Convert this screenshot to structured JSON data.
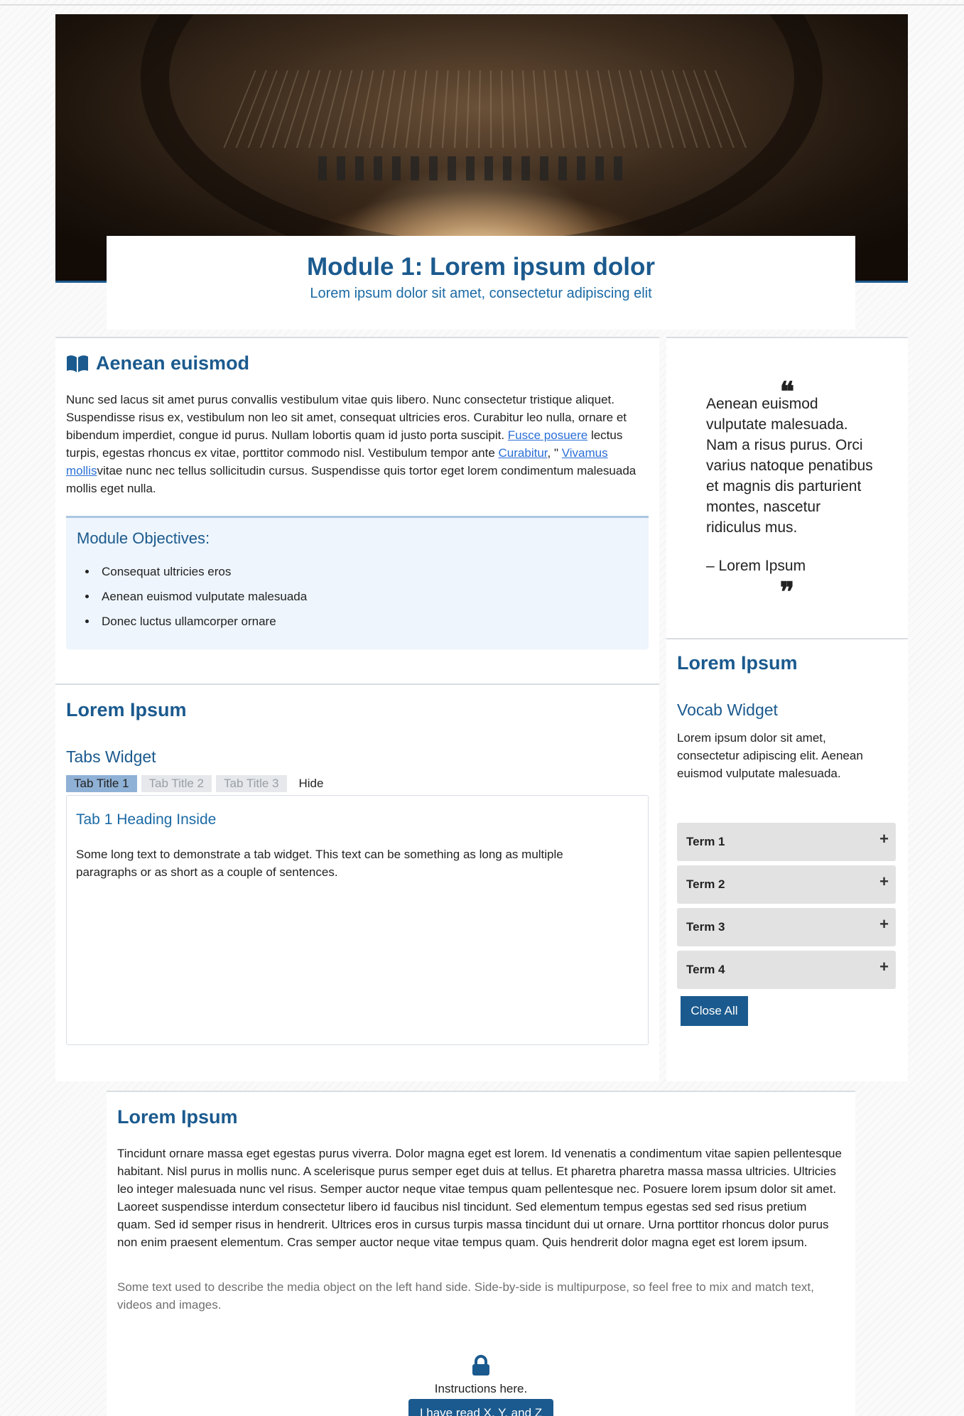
{
  "hero": {
    "title": "Module 1: Lorem ipsum dolor",
    "subtitle": "Lorem ipsum dolor sit amet, consectetur adipiscing elit"
  },
  "intro": {
    "heading": "Aenean euismod",
    "text_1": "Nunc sed lacus sit amet purus convallis vestibulum vitae quis libero. Nunc consectetur tristique aliquet. Suspendisse risus ex, vestibulum non leo sit amet, consequat ultricies eros. Curabitur leo nulla, ornare et bibendum imperdiet, congue id purus. Nullam lobortis quam id justo porta suscipit. ",
    "link_1": "Fusce posuere",
    "text_2": " lectus turpis, egestas rhoncus ex vitae, porttitor commodo nisl. Vestibulum tempor ante ",
    "link_2": "Curabitur",
    "text_3": ", \" ",
    "link_3": "Vivamus mollis",
    "text_4": "vitae nunc nec tellus sollicitudin cursus. Suspendisse quis tortor eget lorem condimentum malesuada mollis eget nulla."
  },
  "objectives": {
    "heading": "Module Objectives:",
    "items": [
      "Consequat ultricies eros",
      "Aenean euismod vulputate malesuada",
      "Donec luctus ullamcorper ornare"
    ]
  },
  "quote": {
    "open_mark": "❝",
    "text": "Aenean euismod vulputate malesuada. Nam a risus purus. Orci varius natoque penatibus et magnis dis parturient montes, nascetur ridiculus mus.",
    "author": "– Lorem Ipsum",
    "close_mark": "❞"
  },
  "tabs_section": {
    "heading": "Lorem Ipsum",
    "widget_title": "Tabs Widget",
    "tabs": [
      "Tab Title 1",
      "Tab Title 2",
      "Tab Title 3"
    ],
    "hide_label": "Hide",
    "active_heading": "Tab 1 Heading Inside",
    "active_text": "Some long text to demonstrate a tab widget. This text can be something as long as multiple paragraphs or as short as a couple of sentences."
  },
  "vocab": {
    "heading": "Lorem Ipsum",
    "widget_title": "Vocab Widget",
    "description": "Lorem ipsum dolor sit amet, consectetur adipiscing elit. Aenean euismod vulputate malesuada.",
    "terms": [
      "Term 1",
      "Term 2",
      "Term 3",
      "Term 4"
    ],
    "expand_symbol": "+",
    "close_all": "Close All"
  },
  "bottom": {
    "heading": "Lorem Ipsum",
    "text": "Tincidunt ornare massa eget egestas purus viverra. Dolor magna eget est lorem. Id venenatis a condimentum vitae sapien pellentesque habitant. Nisl purus in mollis nunc. A scelerisque purus semper eget duis at tellus. Et pharetra pharetra massa massa ultricies. Ultricies leo integer malesuada nunc vel risus. Semper auctor neque vitae tempus quam pellentesque nec. Posuere lorem ipsum dolor sit amet. Laoreet suspendisse interdum consectetur libero id faucibus nisl tincidunt. Sed elementum tempus egestas sed sed risus pretium quam. Sed id semper risus in hendrerit. Ultrices eros in cursus turpis massa tincidunt dui ut ornare. Urna porttitor rhoncus dolor purus non enim praesent elementum. Cras semper auctor neque vitae tempus quam. Quis hendrerit dolor magna eget est lorem ipsum.",
    "caption": "Some text used to describe the media object on the left hand side. Side-by-side is multipurpose, so feel free to mix and match text, videos and images.",
    "instructions": "Instructions here.",
    "button": "I have read X, Y, and Z"
  },
  "colors": {
    "primary": "#1b5a8e",
    "link": "#2a6fd6",
    "objectives_bg": "#eef5fc",
    "active_tab": "#8fb1d6"
  },
  "icons": [
    "book-open-icon",
    "quote-open-icon",
    "quote-close-icon",
    "plus-icon",
    "lock-icon"
  ]
}
